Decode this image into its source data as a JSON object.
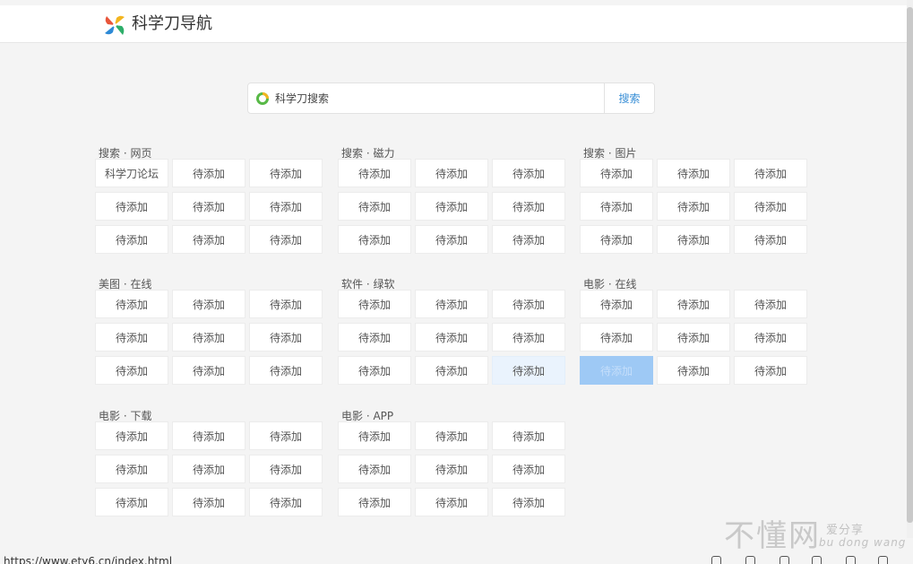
{
  "header": {
    "title": "科学刀导航"
  },
  "search": {
    "placeholder": "科学刀搜索",
    "button_label": "搜索"
  },
  "categories": [
    {
      "title": "搜索 · 网页",
      "items": [
        "科学刀论坛",
        "待添加",
        "待添加",
        "待添加",
        "待添加",
        "待添加",
        "待添加",
        "待添加",
        "待添加"
      ]
    },
    {
      "title": "搜索 · 磁力",
      "items": [
        "待添加",
        "待添加",
        "待添加",
        "待添加",
        "待添加",
        "待添加",
        "待添加",
        "待添加",
        "待添加"
      ]
    },
    {
      "title": "搜索 · 图片",
      "items": [
        "待添加",
        "待添加",
        "待添加",
        "待添加",
        "待添加",
        "待添加",
        "待添加",
        "待添加",
        "待添加"
      ]
    },
    {
      "title": "美图 · 在线",
      "items": [
        "待添加",
        "待添加",
        "待添加",
        "待添加",
        "待添加",
        "待添加",
        "待添加",
        "待添加",
        "待添加"
      ]
    },
    {
      "title": "软件 · 绿软",
      "items": [
        "待添加",
        "待添加",
        "待添加",
        "待添加",
        "待添加",
        "待添加",
        "待添加",
        "待添加",
        "待添加"
      ]
    },
    {
      "title": "电影 · 在线",
      "items": [
        "待添加",
        "待添加",
        "待添加",
        "待添加",
        "待添加",
        "待添加",
        "待添加",
        "待添加",
        "待添加"
      ]
    },
    {
      "title": "电影 · 下载",
      "items": [
        "待添加",
        "待添加",
        "待添加",
        "待添加",
        "待添加",
        "待添加",
        "待添加",
        "待添加",
        "待添加"
      ]
    },
    {
      "title": "电影 · APP",
      "items": [
        "待添加",
        "待添加",
        "待添加",
        "待添加",
        "待添加",
        "待添加",
        "待添加",
        "待添加",
        "待添加"
      ]
    }
  ],
  "status_bar": {
    "url": "https://www.ety6.cn/index.html"
  },
  "watermark": {
    "main": "不懂网",
    "sub1": "爱分享",
    "sub2": "bu dong wang"
  },
  "colors": {
    "accent": "#3a8fd6",
    "cell_hover": "#eaf3fd",
    "cell_active": "#9ec9f5"
  }
}
